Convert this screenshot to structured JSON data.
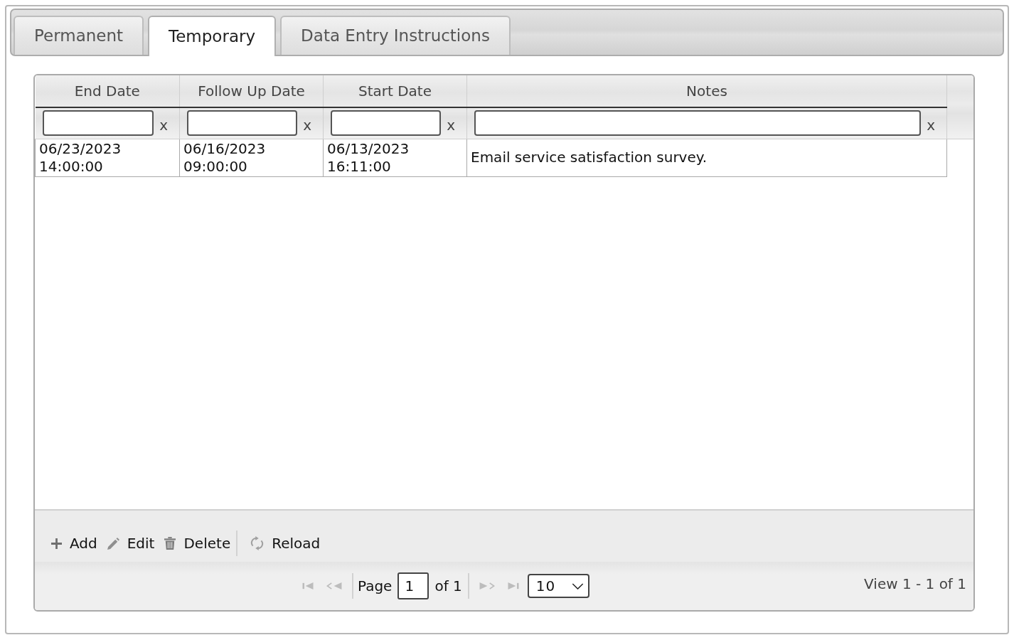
{
  "tabs": [
    {
      "label": "Permanent",
      "selected": false
    },
    {
      "label": "Temporary",
      "selected": true
    },
    {
      "label": "Data Entry Instructions",
      "selected": false
    }
  ],
  "grid": {
    "columns": [
      {
        "label": "End Date",
        "filter_clear": "x"
      },
      {
        "label": "Follow Up Date",
        "filter_clear": "x"
      },
      {
        "label": "Start Date",
        "filter_clear": "x"
      },
      {
        "label": "Notes",
        "filter_clear": "x"
      }
    ],
    "rows": [
      {
        "cells": [
          "06/23/2023 14:00:00",
          "06/16/2023 09:00:00",
          "06/13/2023 16:11:00",
          "Email service satisfaction survey."
        ]
      }
    ]
  },
  "toolbar": [
    {
      "buttons": [
        {
          "kind": "add",
          "label": "Add"
        },
        {
          "kind": "edit",
          "label": "Edit"
        },
        {
          "kind": "delete",
          "label": "Delete"
        }
      ]
    },
    {
      "buttons": [
        {
          "kind": "reload",
          "label": "Reload"
        }
      ]
    }
  ],
  "pager": {
    "nav_before": [
      {
        "kind": "first",
        "disabled": true
      },
      {
        "kind": "prev",
        "disabled": true
      }
    ],
    "page_label": "Page",
    "page_value": "1",
    "page_count_label": "of 1",
    "nav_after": [
      {
        "kind": "next",
        "disabled": true
      },
      {
        "kind": "last",
        "disabled": true
      }
    ],
    "rows_per_page": "10",
    "record_info": "View 1 - 1 of 1"
  }
}
